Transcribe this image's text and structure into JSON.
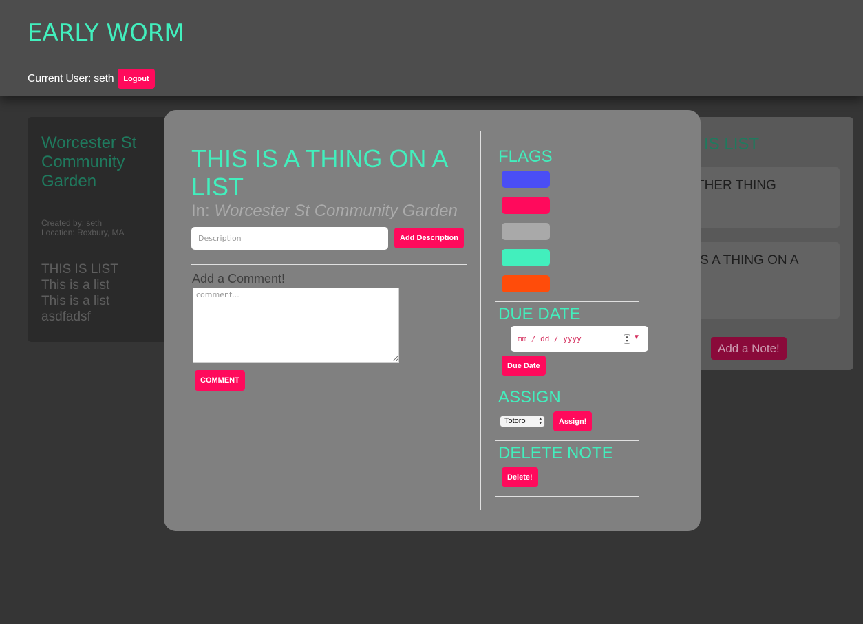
{
  "header": {
    "app_title": "EARLY WORM",
    "current_user_label": "Current User: seth",
    "logout_label": "Logout"
  },
  "background": {
    "garden": {
      "title": "Worcester St Community Garden",
      "created_by": "Created by: seth",
      "location": "Location: Roxbury, MA",
      "lists": [
        "THIS IS LIST",
        "This is a list",
        "This is a list",
        "asdfadsf"
      ]
    },
    "list_panel": {
      "title": "IS LIST",
      "notes": [
        "THER THING",
        "IS A THING ON A"
      ],
      "add_note_label": "Add a Note!"
    }
  },
  "modal": {
    "note_title": "THIS IS A THING ON A LIST",
    "in_prefix": "In:",
    "in_list": "Worcester St Community Garden",
    "description_placeholder": "Description",
    "add_description_label": "Add Description",
    "comment_heading": "Add a Comment!",
    "comment_placeholder": "comment...",
    "comment_button": "COMMENT",
    "flags_heading": "FLAGS",
    "flag_colors": [
      "#4a4ef5",
      "#ff0a5c",
      "#a9a9a9",
      "#42efbd",
      "#ff4c0a"
    ],
    "due_date_heading": "DUE DATE",
    "date_placeholder": "mm / dd / yyyy",
    "due_date_button": "Due Date",
    "assign_heading": "ASSIGN",
    "assign_selected": "Totoro",
    "assign_button": "Assign!",
    "delete_heading": "DELETE NOTE",
    "delete_button": "Delete!"
  },
  "colors": {
    "accent": "#42efbd",
    "button": "#ff0a5c",
    "header_bg": "#4d4d4d",
    "page_bg": "#353535",
    "modal_bg": "#808080"
  }
}
